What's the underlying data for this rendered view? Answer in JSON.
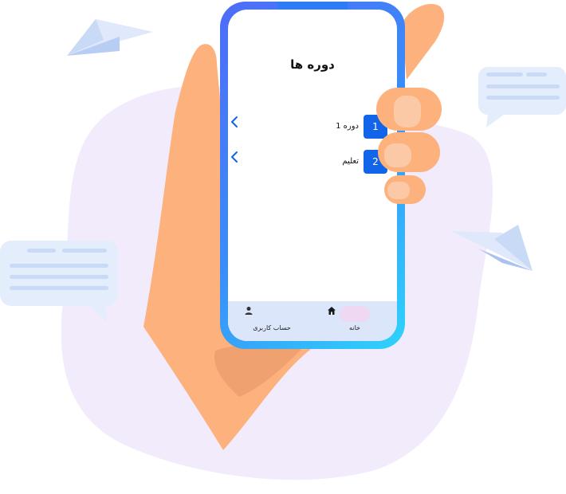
{
  "screen": {
    "title": "دوره ها",
    "rows": [
      {
        "badge": "1",
        "label": "دوره 1"
      },
      {
        "badge": "2",
        "label": "تعلیم"
      }
    ]
  },
  "nav": {
    "home": {
      "label": "خانه",
      "icon": "home-icon"
    },
    "account": {
      "label": "حساب کاربری",
      "icon": "user-icon"
    }
  },
  "colors": {
    "accent": "#1264e8",
    "hand": "#fdb17d",
    "blob": "#f1ebfb",
    "nav_bg": "#dce6fb"
  }
}
